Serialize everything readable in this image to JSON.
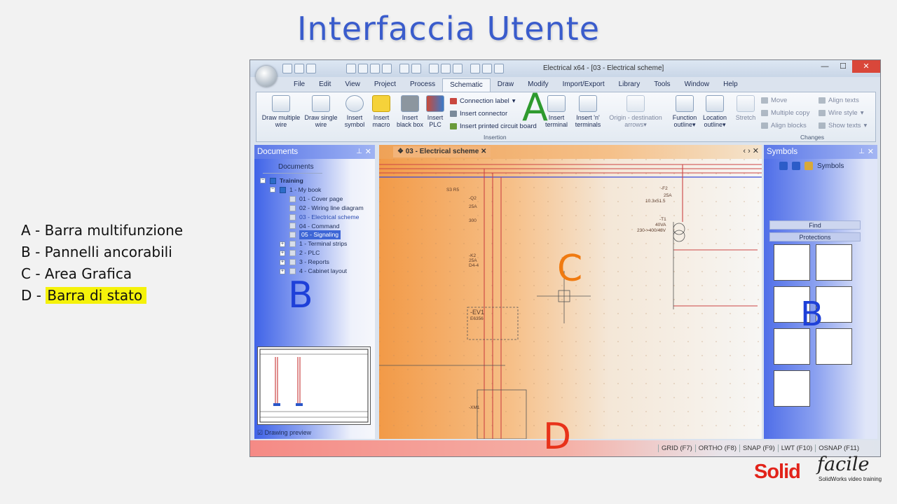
{
  "slide": {
    "title": "Interfaccia Utente",
    "legend": [
      {
        "letter": "A",
        "sep": " - ",
        "text": "Barra multifunzione"
      },
      {
        "letter": "B",
        "sep": " - ",
        "text": "Pannelli ancorabili"
      },
      {
        "letter": "C",
        "sep": " - ",
        "text": "Area Grafica"
      },
      {
        "letter": "D",
        "sep": " - ",
        "text": "Barra di stato"
      }
    ],
    "overlay_letters": {
      "A": "A",
      "B": "B",
      "C": "C",
      "D": "D"
    },
    "colors": {
      "title": "#3a5ccc",
      "highlight": "#f5f20a",
      "letter_A": "#2e9a2e",
      "letter_B": "#1e40d8",
      "letter_C": "#f07a10",
      "letter_D": "#e8321a"
    },
    "logo": {
      "solid": "Solid",
      "facile": "facile",
      "tagline": "SolidWorks video training"
    }
  },
  "app": {
    "window_title": "Electrical x64 - [03 - Electrical scheme]",
    "window_buttons": {
      "minimize": "—",
      "maximize": "☐",
      "close": "✕"
    },
    "menu": [
      "File",
      "Edit",
      "View",
      "Project",
      "Process",
      "Schematic",
      "Draw",
      "Modify",
      "Import/Export",
      "Library",
      "Tools",
      "Window",
      "Help"
    ],
    "active_menu": "Schematic",
    "ribbon": {
      "draw_multiple_wire": "Draw multiple wire",
      "draw_single_wire": "Draw single wire",
      "insert_symbol": "Insert symbol",
      "insert_macro": "Insert macro",
      "insert_black_box": "Insert black box",
      "insert_plc": "Insert PLC",
      "connection_label": "Connection label",
      "insert_connector": "Insert connector",
      "insert_printed_circuit_board": "Insert printed circuit board",
      "insert_terminal": "Insert terminal",
      "insert_n_terminals": "Insert 'n' terminals",
      "origin_destination_arrows": "Origin - destination arrows",
      "function_outline": "Function outline",
      "location_outline": "Location outline",
      "stretch": "Stretch",
      "move": "Move",
      "multiple_copy": "Multiple copy",
      "align_blocks": "Align blocks",
      "align_texts": "Align texts",
      "wire_style": "Wire style",
      "show_texts": "Show texts",
      "group_insertion": "Insertion",
      "group_changes": "Changes"
    },
    "documents_panel": {
      "title": "Documents",
      "tab": "Documents",
      "tree": [
        {
          "label": "Training",
          "level": 0,
          "bold": true
        },
        {
          "label": "1 - My book",
          "level": 1
        },
        {
          "label": "01 - Cover page",
          "level": 2
        },
        {
          "label": "02 - Wiring line diagram",
          "level": 2
        },
        {
          "label": "03 - Electrical scheme",
          "level": 2
        },
        {
          "label": "04 - Command",
          "level": 2
        },
        {
          "label": "05 - Signaling",
          "level": 2,
          "selected": true
        },
        {
          "label": "1 - Terminal strips",
          "level": 1
        },
        {
          "label": "2 - PLC",
          "level": 1
        },
        {
          "label": "3 - Reports",
          "level": 1
        },
        {
          "label": "4 - Cabinet layout",
          "level": 1
        }
      ],
      "drawing_preview": "Drawing preview"
    },
    "document_tab": "03 - Electrical scheme",
    "schematic_labels": {
      "q2": "-Q2",
      "q2_amp": "25A",
      "q2_val": "300",
      "k2": "-K2",
      "k2_amp": "25A",
      "k2_mode": "D4-4",
      "ev1": "-EV1",
      "ev1_ref": "E6356",
      "f2": "-F2",
      "f2_amp": "25A",
      "f2_rating": "10.3x51.5",
      "t1": "-T1",
      "t1_power": "40VA",
      "t1_voltage": "230->400/48V",
      "xm1": "-XM1",
      "s3": "S3 R5"
    },
    "symbols_panel": {
      "title": "Symbols",
      "tab": "Symbols",
      "find": "Find",
      "category": "Protections"
    },
    "statusbar": [
      "GRID (F7)",
      "ORTHO (F8)",
      "SNAP (F9)",
      "LWT (F10)",
      "OSNAP (F11)"
    ]
  }
}
